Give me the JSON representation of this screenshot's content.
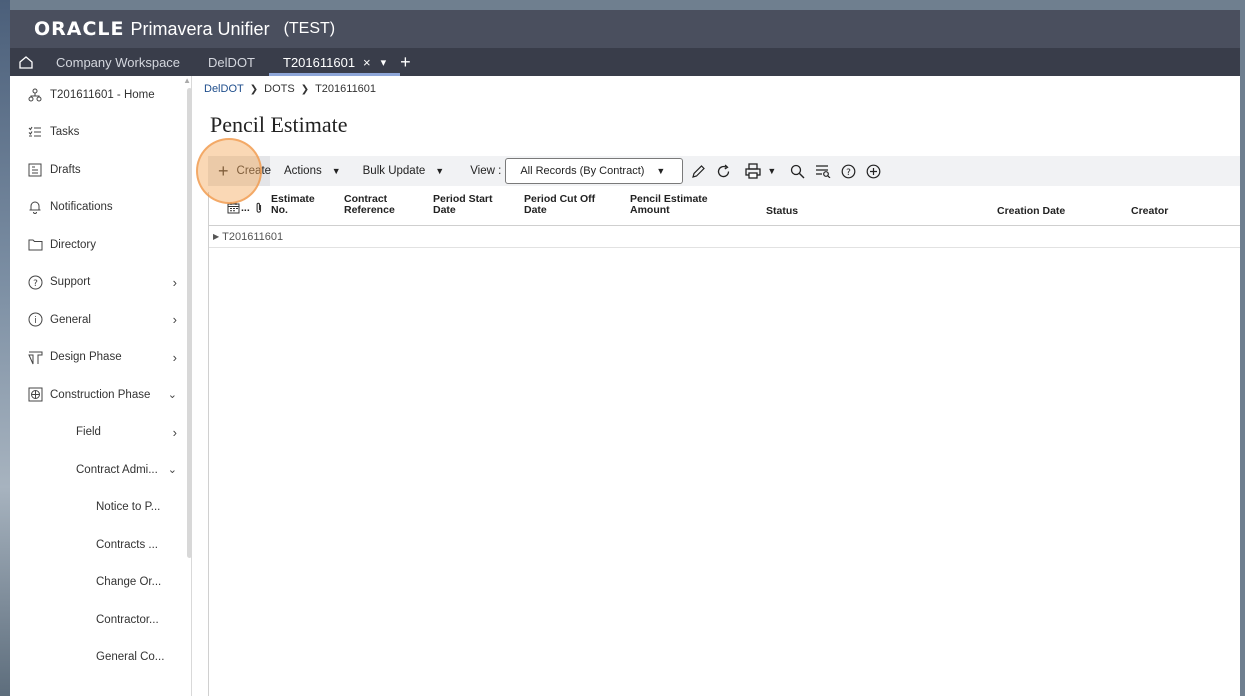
{
  "app": {
    "brand": "ORACLE",
    "product": "Primavera Unifier",
    "environment": "(TEST)"
  },
  "tabs": [
    {
      "label": "Company Workspace"
    },
    {
      "label": "DelDOT"
    },
    {
      "label": "T201611601",
      "active": true
    }
  ],
  "breadcrumb": [
    "DelDOT",
    "DOTS",
    "T201611601"
  ],
  "sidebar": {
    "items": [
      {
        "label": "T201611601 - Home",
        "icon": "project-tree-icon"
      },
      {
        "label": "Tasks",
        "icon": "tasks-icon"
      },
      {
        "label": "Drafts",
        "icon": "drafts-icon"
      },
      {
        "label": "Notifications",
        "icon": "bell-icon"
      },
      {
        "label": "Directory",
        "icon": "folder-icon"
      },
      {
        "label": "Support",
        "icon": "help-circle-icon"
      },
      {
        "label": "General",
        "icon": "info-circle-icon"
      },
      {
        "label": "Design Phase",
        "icon": "pipe-icon"
      },
      {
        "label": "Construction Phase",
        "icon": "construction-icon"
      },
      {
        "label": "Field"
      },
      {
        "label": "Contract Admi..."
      },
      {
        "label": "Notice to P..."
      },
      {
        "label": "Contracts ..."
      },
      {
        "label": "Change Or..."
      },
      {
        "label": "Contractor..."
      },
      {
        "label": "General Co..."
      }
    ]
  },
  "page": {
    "title": "Pencil Estimate"
  },
  "toolbar": {
    "create": "Create",
    "actions": "Actions",
    "bulk_update": "Bulk Update",
    "view_label": "View :",
    "view_value": "All Records (By Contract)"
  },
  "grid": {
    "columns": [
      {
        "line1": "Estimate",
        "line2": "No."
      },
      {
        "line1": "Contract",
        "line2": "Reference"
      },
      {
        "line1": "Period Start",
        "line2": "Date"
      },
      {
        "line1": "Period Cut Off",
        "line2": "Date"
      },
      {
        "line1": "Pencil Estimate",
        "line2": "Amount"
      },
      {
        "line1": "Status",
        "line2": ""
      },
      {
        "line1": "Creation Date",
        "line2": ""
      },
      {
        "line1": "Creator",
        "line2": ""
      }
    ],
    "icon_column_label": "...",
    "groups": [
      "T201611601"
    ]
  },
  "colors": {
    "topbar": "#4a4f5e",
    "tabbar": "#393d4a",
    "highlight": "#f3a85c",
    "link": "#1f4e8c"
  }
}
